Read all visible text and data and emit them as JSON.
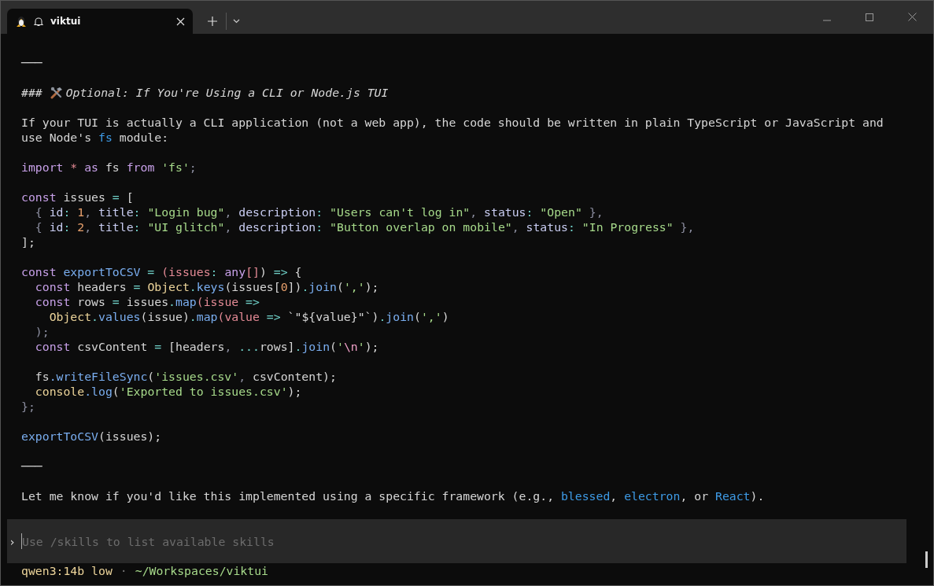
{
  "tabs": [
    {
      "title": "viktui",
      "selected": true
    }
  ],
  "lines": [
    {
      "kind": "rule",
      "tokens": [
        {
          "text": "───",
          "kind": "plain"
        }
      ]
    },
    {
      "kind": "blank"
    },
    {
      "kind": "heading",
      "tokens": [
        {
          "text": "### ",
          "kind": "plain"
        },
        {
          "text": "Optional: If You're Using a CLI or Node.js TUI",
          "kind": "plain"
        }
      ]
    },
    {
      "kind": "blank"
    },
    {
      "kind": "text",
      "tokens": [
        {
          "text": "If your TUI is actually a CLI application (not a web app), the code should be written in plain TypeScript or JavaScript and",
          "kind": "plain"
        }
      ]
    },
    {
      "kind": "text",
      "tokens": [
        {
          "text": "use Node's ",
          "kind": "plain"
        },
        {
          "text": "fs",
          "kind": "link"
        },
        {
          "text": " module:",
          "kind": "plain"
        }
      ]
    },
    {
      "kind": "blank"
    },
    {
      "kind": "code",
      "tokens": [
        {
          "text": "import",
          "kind": "keyword"
        },
        {
          "text": " *",
          "kind": "param"
        },
        {
          "text": " as",
          "kind": "keyword"
        },
        {
          "text": " fs ",
          "kind": "plain"
        },
        {
          "text": "from",
          "kind": "keyword"
        },
        {
          "text": " 'fs'",
          "kind": "string"
        },
        {
          "text": ";",
          "kind": "punct"
        }
      ]
    },
    {
      "kind": "blank"
    },
    {
      "kind": "code",
      "tokens": [
        {
          "text": "const",
          "kind": "keyword"
        },
        {
          "text": " issues ",
          "kind": "plain"
        },
        {
          "text": "=",
          "kind": "operator"
        },
        {
          "text": " [",
          "kind": "plain"
        }
      ]
    },
    {
      "kind": "code",
      "tokens": [
        {
          "text": "  { ",
          "kind": "punct"
        },
        {
          "text": "id",
          "kind": "property"
        },
        {
          "text": ": ",
          "kind": "operator"
        },
        {
          "text": "1",
          "kind": "number"
        },
        {
          "text": ", ",
          "kind": "punct"
        },
        {
          "text": "title",
          "kind": "property"
        },
        {
          "text": ": ",
          "kind": "operator"
        },
        {
          "text": "\"Login bug\"",
          "kind": "string"
        },
        {
          "text": ", ",
          "kind": "punct"
        },
        {
          "text": "description",
          "kind": "property"
        },
        {
          "text": ": ",
          "kind": "operator"
        },
        {
          "text": "\"Users can't log in\"",
          "kind": "string"
        },
        {
          "text": ", ",
          "kind": "punct"
        },
        {
          "text": "status",
          "kind": "property"
        },
        {
          "text": ": ",
          "kind": "operator"
        },
        {
          "text": "\"Open\"",
          "kind": "string"
        },
        {
          "text": " },",
          "kind": "punct"
        }
      ]
    },
    {
      "kind": "code",
      "tokens": [
        {
          "text": "  { ",
          "kind": "punct"
        },
        {
          "text": "id",
          "kind": "property"
        },
        {
          "text": ": ",
          "kind": "operator"
        },
        {
          "text": "2",
          "kind": "number"
        },
        {
          "text": ", ",
          "kind": "punct"
        },
        {
          "text": "title",
          "kind": "property"
        },
        {
          "text": ": ",
          "kind": "operator"
        },
        {
          "text": "\"UI glitch\"",
          "kind": "string"
        },
        {
          "text": ", ",
          "kind": "punct"
        },
        {
          "text": "description",
          "kind": "property"
        },
        {
          "text": ": ",
          "kind": "operator"
        },
        {
          "text": "\"Button overlap on mobile\"",
          "kind": "string"
        },
        {
          "text": ", ",
          "kind": "punct"
        },
        {
          "text": "status",
          "kind": "property"
        },
        {
          "text": ": ",
          "kind": "operator"
        },
        {
          "text": "\"In Progress\"",
          "kind": "string"
        },
        {
          "text": " },",
          "kind": "punct"
        }
      ]
    },
    {
      "kind": "code",
      "tokens": [
        {
          "text": "];",
          "kind": "plain"
        }
      ]
    },
    {
      "kind": "blank"
    },
    {
      "kind": "code",
      "tokens": [
        {
          "text": "const",
          "kind": "keyword"
        },
        {
          "text": " exportToCSV",
          "kind": "func"
        },
        {
          "text": " =",
          "kind": "operator"
        },
        {
          "text": " (",
          "kind": "param"
        },
        {
          "text": "issues",
          "kind": "param"
        },
        {
          "text": ": ",
          "kind": "operator"
        },
        {
          "text": "any",
          "kind": "keyword"
        },
        {
          "text": "[]",
          "kind": "param"
        },
        {
          "text": ") ",
          "kind": "plain"
        },
        {
          "text": "=>",
          "kind": "operator"
        },
        {
          "text": " {",
          "kind": "plain"
        }
      ]
    },
    {
      "kind": "code",
      "tokens": [
        {
          "text": "  const",
          "kind": "keyword"
        },
        {
          "text": " headers ",
          "kind": "plain"
        },
        {
          "text": "=",
          "kind": "operator"
        },
        {
          "text": " Object",
          "kind": "class"
        },
        {
          "text": ".",
          "kind": "operator"
        },
        {
          "text": "keys",
          "kind": "func"
        },
        {
          "text": "(issues[",
          "kind": "plain"
        },
        {
          "text": "0",
          "kind": "number"
        },
        {
          "text": "])",
          "kind": "plain"
        },
        {
          "text": ".",
          "kind": "operator"
        },
        {
          "text": "join",
          "kind": "func"
        },
        {
          "text": "(",
          "kind": "plain"
        },
        {
          "text": "','",
          "kind": "string"
        },
        {
          "text": ");",
          "kind": "plain"
        }
      ]
    },
    {
      "kind": "code",
      "tokens": [
        {
          "text": "  const",
          "kind": "keyword"
        },
        {
          "text": " rows ",
          "kind": "plain"
        },
        {
          "text": "=",
          "kind": "operator"
        },
        {
          "text": " issues",
          "kind": "plain"
        },
        {
          "text": ".",
          "kind": "operator"
        },
        {
          "text": "map",
          "kind": "func"
        },
        {
          "text": "(issue",
          "kind": "param"
        },
        {
          "text": " =>",
          "kind": "operator"
        }
      ]
    },
    {
      "kind": "code",
      "tokens": [
        {
          "text": "    Object",
          "kind": "class"
        },
        {
          "text": ".",
          "kind": "operator"
        },
        {
          "text": "values",
          "kind": "func"
        },
        {
          "text": "(issue)",
          "kind": "plain"
        },
        {
          "text": ".",
          "kind": "operator"
        },
        {
          "text": "map",
          "kind": "func"
        },
        {
          "text": "(value",
          "kind": "param"
        },
        {
          "text": " =>",
          "kind": "operator"
        },
        {
          "text": " `\"${value}\"`",
          "kind": "plain"
        },
        {
          "text": ")",
          "kind": "plain"
        },
        {
          "text": ".",
          "kind": "operator"
        },
        {
          "text": "join",
          "kind": "func"
        },
        {
          "text": "(",
          "kind": "plain"
        },
        {
          "text": "','",
          "kind": "string"
        },
        {
          "text": ")",
          "kind": "plain"
        }
      ]
    },
    {
      "kind": "code",
      "tokens": [
        {
          "text": "  );",
          "kind": "punct"
        }
      ]
    },
    {
      "kind": "code",
      "tokens": [
        {
          "text": "  const",
          "kind": "keyword"
        },
        {
          "text": " csvContent ",
          "kind": "plain"
        },
        {
          "text": "=",
          "kind": "operator"
        },
        {
          "text": " [headers",
          "kind": "plain"
        },
        {
          "text": ", ",
          "kind": "punct"
        },
        {
          "text": "...",
          "kind": "operator"
        },
        {
          "text": "rows]",
          "kind": "plain"
        },
        {
          "text": ".",
          "kind": "operator"
        },
        {
          "text": "join",
          "kind": "func"
        },
        {
          "text": "(",
          "kind": "plain"
        },
        {
          "text": "'",
          "kind": "string"
        },
        {
          "text": "\\n",
          "kind": "escape"
        },
        {
          "text": "'",
          "kind": "string"
        },
        {
          "text": ");",
          "kind": "plain"
        }
      ]
    },
    {
      "kind": "blank"
    },
    {
      "kind": "code",
      "tokens": [
        {
          "text": "  fs",
          "kind": "plain"
        },
        {
          "text": ".writeFileSync",
          "kind": "func"
        },
        {
          "text": "(",
          "kind": "plain"
        },
        {
          "text": "'issues.csv'",
          "kind": "string"
        },
        {
          "text": ", ",
          "kind": "punct"
        },
        {
          "text": "csvContent);",
          "kind": "plain"
        }
      ]
    },
    {
      "kind": "code",
      "tokens": [
        {
          "text": "  console",
          "kind": "class"
        },
        {
          "text": ".log",
          "kind": "func"
        },
        {
          "text": "(",
          "kind": "plain"
        },
        {
          "text": "'Exported to issues.csv'",
          "kind": "string"
        },
        {
          "text": ");",
          "kind": "plain"
        }
      ]
    },
    {
      "kind": "code",
      "tokens": [
        {
          "text": "};",
          "kind": "punct"
        }
      ]
    },
    {
      "kind": "blank"
    },
    {
      "kind": "code",
      "tokens": [
        {
          "text": "exportToCSV",
          "kind": "func"
        },
        {
          "text": "(issues);",
          "kind": "plain"
        }
      ]
    },
    {
      "kind": "blank"
    },
    {
      "kind": "rule",
      "tokens": [
        {
          "text": "───",
          "kind": "plain"
        }
      ]
    },
    {
      "kind": "blank"
    },
    {
      "kind": "text",
      "tokens": [
        {
          "text": "Let me know if you'd like this implemented using a specific framework (e.g., ",
          "kind": "plain"
        },
        {
          "text": "blessed",
          "kind": "link"
        },
        {
          "text": ", ",
          "kind": "plain"
        },
        {
          "text": "electron",
          "kind": "link"
        },
        {
          "text": ", or ",
          "kind": "plain"
        },
        {
          "text": "React",
          "kind": "link"
        },
        {
          "text": ").",
          "kind": "plain"
        }
      ]
    }
  ],
  "prompt": {
    "symbol": "›",
    "placeholder": "Use /skills to list available skills"
  },
  "status_bar": {
    "model": "qwen3:14b low",
    "separator": "·",
    "path": "~/Workspaces/viktui"
  }
}
